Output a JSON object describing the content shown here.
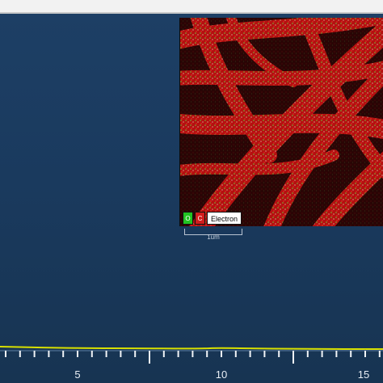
{
  "inset": {
    "legend": {
      "o_label": "O",
      "c_label": "C",
      "electron_label": "Electron"
    },
    "scale_label": "1um",
    "colors": {
      "fiber": "#c81414",
      "background": "#220404",
      "o_chip": "#22c322",
      "c_chip": "#d11d1d"
    }
  },
  "axis": {
    "ticks": [
      "5",
      "10",
      "15"
    ],
    "range": [
      0,
      16
    ],
    "minor_step": 0.5,
    "spectrum_color": "#d8e000"
  }
}
